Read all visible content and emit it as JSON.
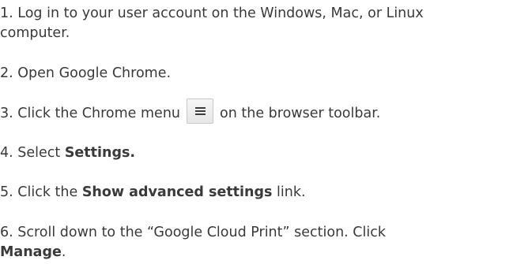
{
  "steps": {
    "s1": {
      "line1": "1. Log in to your user account on the Windows, Mac, or Linux",
      "line2": "computer."
    },
    "s2": {
      "text": "2. Open Google Chrome."
    },
    "s3": {
      "before": "3. Click the Chrome menu",
      "after": "on the browser toolbar.",
      "icon": "chrome-menu-hamburger-icon"
    },
    "s4": {
      "before": "4. Select ",
      "bold": "Settings."
    },
    "s5": {
      "before": "5. Click the ",
      "bold": "Show advanced settings",
      "after": " link."
    },
    "s6": {
      "line1": "6. Scroll down to the “Google Cloud Print” section. Click",
      "bold": "Manage",
      "after": "."
    }
  }
}
